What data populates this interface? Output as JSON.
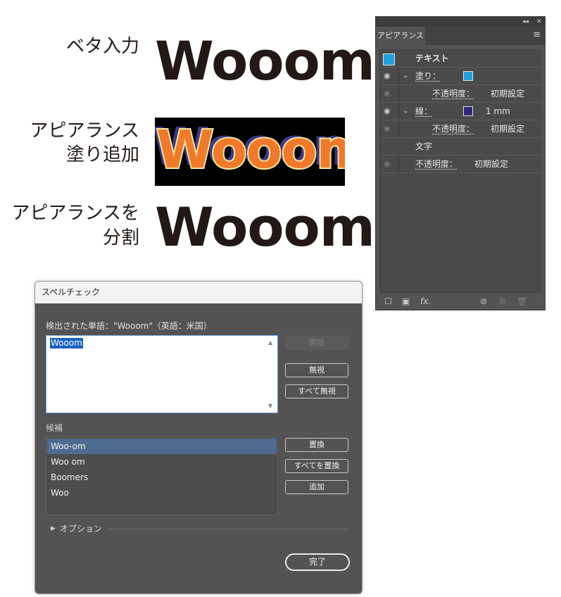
{
  "specimens": {
    "row1": {
      "label": "ベタ入力",
      "word": "Wooom"
    },
    "row2": {
      "label_line1": "アピアランス",
      "label_line2": "塗り追加",
      "word": "Wooom"
    },
    "row3": {
      "label_line1": "アピアランスを",
      "label_line2": "分割",
      "word": "Wooom"
    }
  },
  "appearance_panel": {
    "tab": "アピアランス",
    "rows": [
      {
        "label": "テキスト"
      },
      {
        "label": "塗り："
      },
      {
        "label": "不透明度：",
        "value": "初期設定"
      },
      {
        "label": "線：",
        "value": "1 mm"
      },
      {
        "label": "不透明度：",
        "value": "初期設定"
      },
      {
        "label": "文字"
      },
      {
        "label": "不透明度：",
        "value": "初期設定"
      }
    ],
    "colors": {
      "fill_swatch": "#1ea0e0",
      "stroke_swatch": "#2e2a78"
    },
    "fx_label": "fx."
  },
  "spellcheck": {
    "title": "スペルチェック",
    "detected_label": "検出された単語：\"Wooom\"（英語：米国）",
    "detected_word": "Wooom",
    "buttons": {
      "start": "開始",
      "ignore": "無視",
      "ignore_all": "すべて無視",
      "replace": "置換",
      "replace_all": "すべてを置換",
      "add": "追加",
      "done": "完了"
    },
    "suggestions_label": "候補",
    "suggestions": [
      "Woo-om",
      "Woo om",
      "Boomers",
      "Woo"
    ],
    "selected_suggestion": "Woo-om",
    "options_label": "オプション"
  }
}
